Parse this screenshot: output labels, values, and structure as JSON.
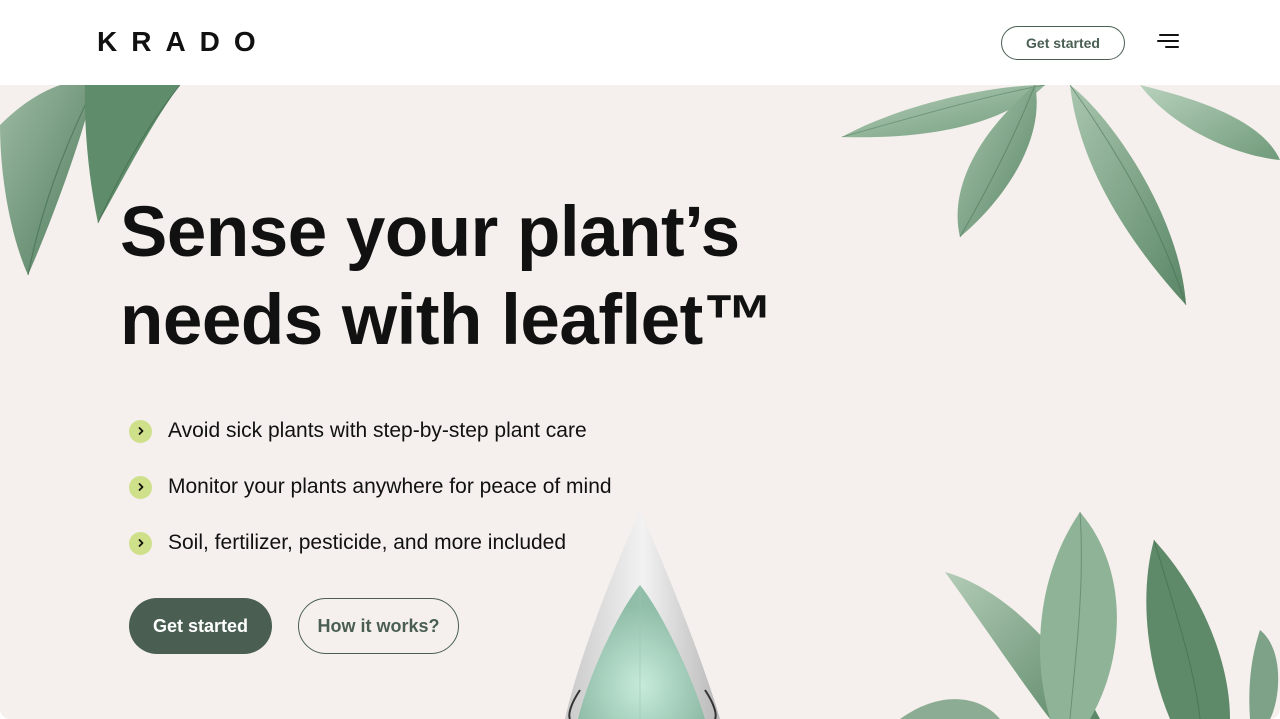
{
  "header": {
    "logo": "KRADO",
    "cta_label": "Get started",
    "menu_icon": "menu-icon"
  },
  "hero": {
    "headline_line1": "Sense your plant’s",
    "headline_line2": "needs with leaflet™",
    "features": [
      "Avoid sick plants with step-by-step plant care",
      "Monitor your plants anywhere for peace of mind",
      "Soil, fertilizer, pesticide, and more included"
    ],
    "primary_cta": "Get started",
    "secondary_cta": "How it works?"
  },
  "colors": {
    "hero_background": "#f5f0ed",
    "accent_dark_green": "#4a5f52",
    "bullet_lime": "#cfe08a",
    "leaf_green": "#7fa588"
  }
}
